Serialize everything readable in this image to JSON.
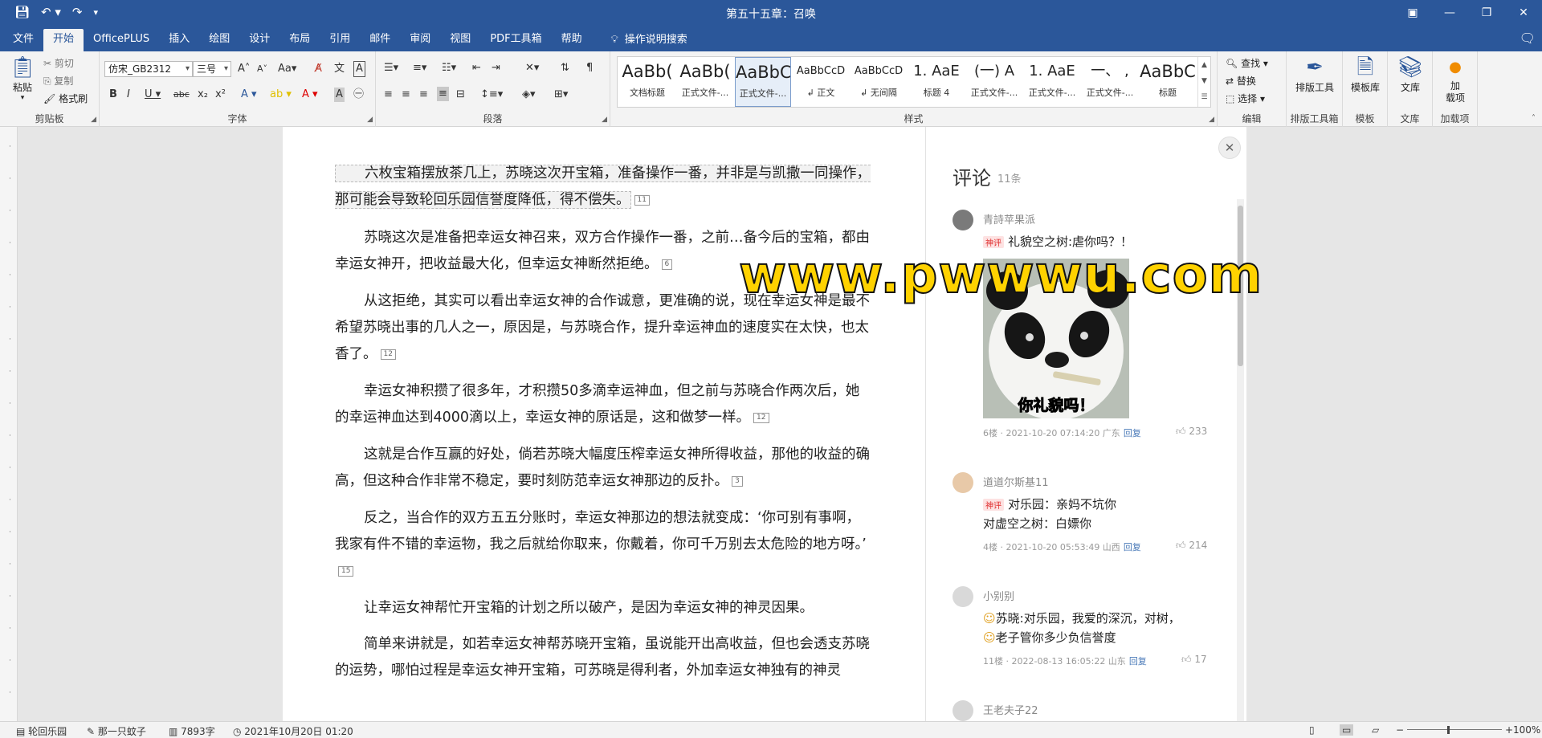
{
  "window": {
    "title": "第五十五章：召唤"
  },
  "tabs": [
    "文件",
    "开始",
    "OfficePLUS",
    "插入",
    "绘图",
    "设计",
    "布局",
    "引用",
    "邮件",
    "审阅",
    "视图",
    "PDF工具箱",
    "帮助"
  ],
  "active_tab": "开始",
  "tell_me": "操作说明搜索",
  "ribbon": {
    "clipboard": {
      "paste": "粘贴",
      "cut": "剪切",
      "copy": "复制",
      "format_painter": "格式刷",
      "label": "剪贴板"
    },
    "font": {
      "name": "仿宋_GB2312",
      "size": "三号",
      "label": "字体"
    },
    "paragraph": {
      "label": "段落"
    },
    "styles": {
      "label": "样式",
      "items": [
        {
          "sample": "AaBb(",
          "name": "文档标题"
        },
        {
          "sample": "AaBb(",
          "name": "正式文件-..."
        },
        {
          "sample": "AaBbC",
          "name": "正式文件-..."
        },
        {
          "sample": "AaBbCcD",
          "name": "↲ 正文"
        },
        {
          "sample": "AaBbCcD",
          "name": "↲ 无间隔"
        },
        {
          "sample": "1. AaE",
          "name": "标题 4"
        },
        {
          "sample": "(一) A",
          "name": "正式文件-..."
        },
        {
          "sample": "1. AaE",
          "name": "正式文件-..."
        },
        {
          "sample": "一、 ,",
          "name": "正式文件-..."
        },
        {
          "sample": "AaBbC",
          "name": "标题"
        }
      ]
    },
    "editing": {
      "find": "查找",
      "replace": "替换",
      "select": "选择",
      "label": "编辑"
    },
    "layout_tools": {
      "button": "排版工具",
      "label": "排版工具箱"
    },
    "template": {
      "button": "模板库",
      "label": "模板"
    },
    "library": {
      "button": "文库",
      "label": "文库"
    },
    "addins": {
      "button": "加\n载项",
      "label": "加载项"
    }
  },
  "document": {
    "paragraphs": [
      "六枚宝箱摆放茶几上，苏晓这次开宝箱，准备操作一番，并非是与凯撒一同操作，那可能会导致轮回乐园信誉度降低，得不偿失。",
      "苏晓这次是准备把幸运女神召来，双方合作操作一番，之前…备今后的宝箱，都由幸运女神开，把收益最大化，但幸运女神断然拒绝。",
      "从这拒绝，其实可以看出幸运女神的合作诚意，更准确的说，现在幸运女神是最不希望苏晓出事的几人之一，原因是，与苏晓合作，提升幸运神血的速度实在太快，也太香了。",
      "幸运女神积攒了很多年，才积攒50多滴幸运神血，但之前与苏晓合作两次后，她的幸运神血达到4000滴以上，幸运女神的原话是，这和做梦一样。",
      "这就是合作互赢的好处，倘若苏晓大幅度压榨幸运女神所得收益，那他的收益的确高，但这种合作非常不稳定，要时刻防范幸运女神那边的反扑。",
      "反之，当合作的双方五五分账时，幸运女神那边的想法就变成：‘你可别有事啊，我家有件不错的幸运物，我之后就给你取来，你戴着，你可千万别去太危险的地方呀。’",
      "让幸运女神帮忙开宝箱的计划之所以破产，是因为幸运女神的神灵因果。",
      "简单来讲就是，如若幸运女神帮苏晓开宝箱，虽说能开出高收益，但也会透支苏晓的运势，哪怕过程是幸运女神开宝箱，可苏晓是得利者，外加幸运女神独有的神灵"
    ],
    "comment_marks": [
      "11",
      "6",
      "12",
      "12",
      "3",
      "15"
    ]
  },
  "comments": {
    "title": "评论",
    "count": "11条",
    "items": [
      {
        "user": "青詩苹果派",
        "tag": "神评",
        "lines": [
          "礼貌空之树:虐你吗？！"
        ],
        "sticker_text": "你礼貌吗！",
        "meta": "6楼 · 2021-10-20 07:14:20 广东",
        "reply": "回复",
        "likes": "233"
      },
      {
        "user": "道道尔斯基11",
        "tag": "神评",
        "lines": [
          "对乐园：亲妈不坑你",
          "对虚空之树：白嫖你"
        ],
        "meta": "4楼 · 2021-10-20 05:53:49 山西",
        "reply": "回复",
        "likes": "214"
      },
      {
        "user": "小别别",
        "lines": [
          "苏晓:对乐园，我爱的深沉，对树，",
          "老子管你多少负信誉度"
        ],
        "meta": "11楼 · 2022-08-13 16:05:22 山东",
        "reply": "回复",
        "likes": "17"
      },
      {
        "user": "王老夫子22"
      }
    ]
  },
  "watermark": "www.pwwwu.com",
  "status": {
    "page": "轮回乐园",
    "author": "那一只蚊子",
    "words": "7893字",
    "time": "2021年10月20日 01:20",
    "zoom": "100%"
  }
}
